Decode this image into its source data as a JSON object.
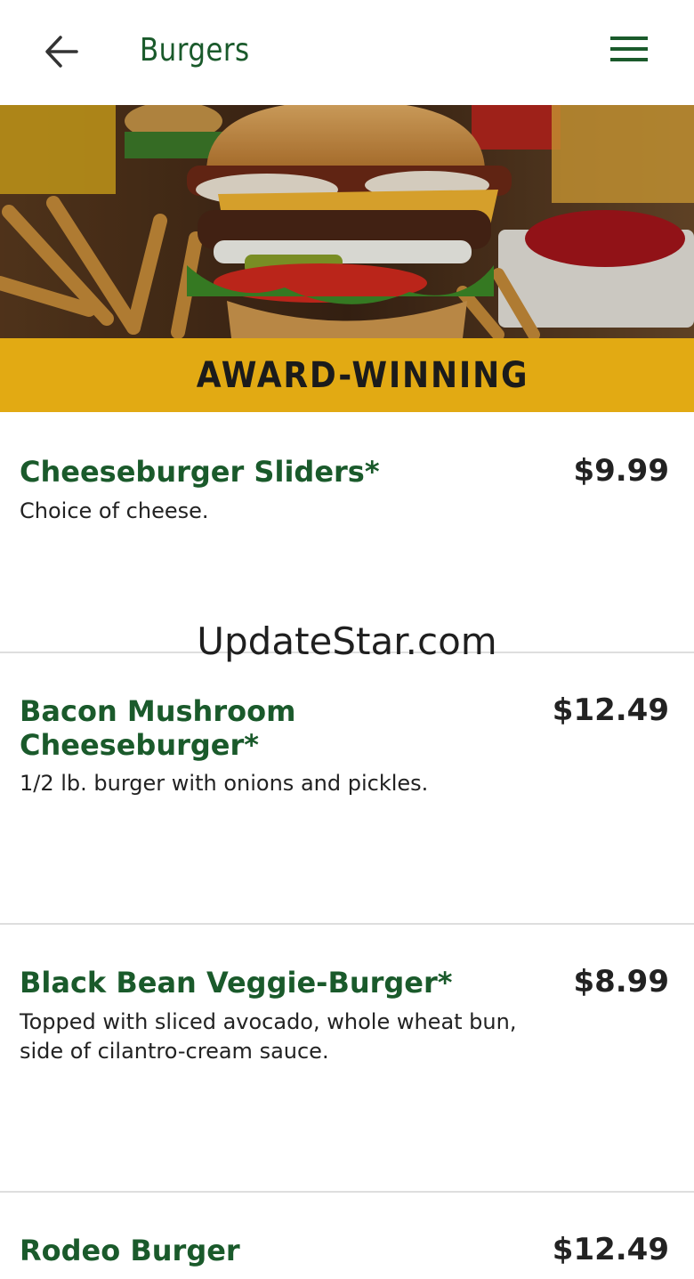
{
  "header": {
    "title": "Burgers",
    "back_icon": "arrow-left-icon",
    "menu_icon": "hamburger-menu-icon",
    "accent": "#1a5a2b"
  },
  "banner": {
    "text": "AWARD-WINNING",
    "color": "#e2aa13"
  },
  "watermark": "UpdateStar.com",
  "items": [
    {
      "name": "Cheeseburger Sliders*",
      "price": "$9.99",
      "description": "Choice of cheese."
    },
    {
      "name": "Bacon Mushroom Cheeseburger*",
      "price": "$12.49",
      "description": "1/2 lb. burger with onions and pickles."
    },
    {
      "name": "Black Bean Veggie-Burger*",
      "price": "$8.99",
      "description": "Topped with sliced avocado, whole wheat bun, side of cilantro-cream sauce."
    },
    {
      "name": "Rodeo Burger",
      "price": "$12.49",
      "description": ""
    }
  ]
}
